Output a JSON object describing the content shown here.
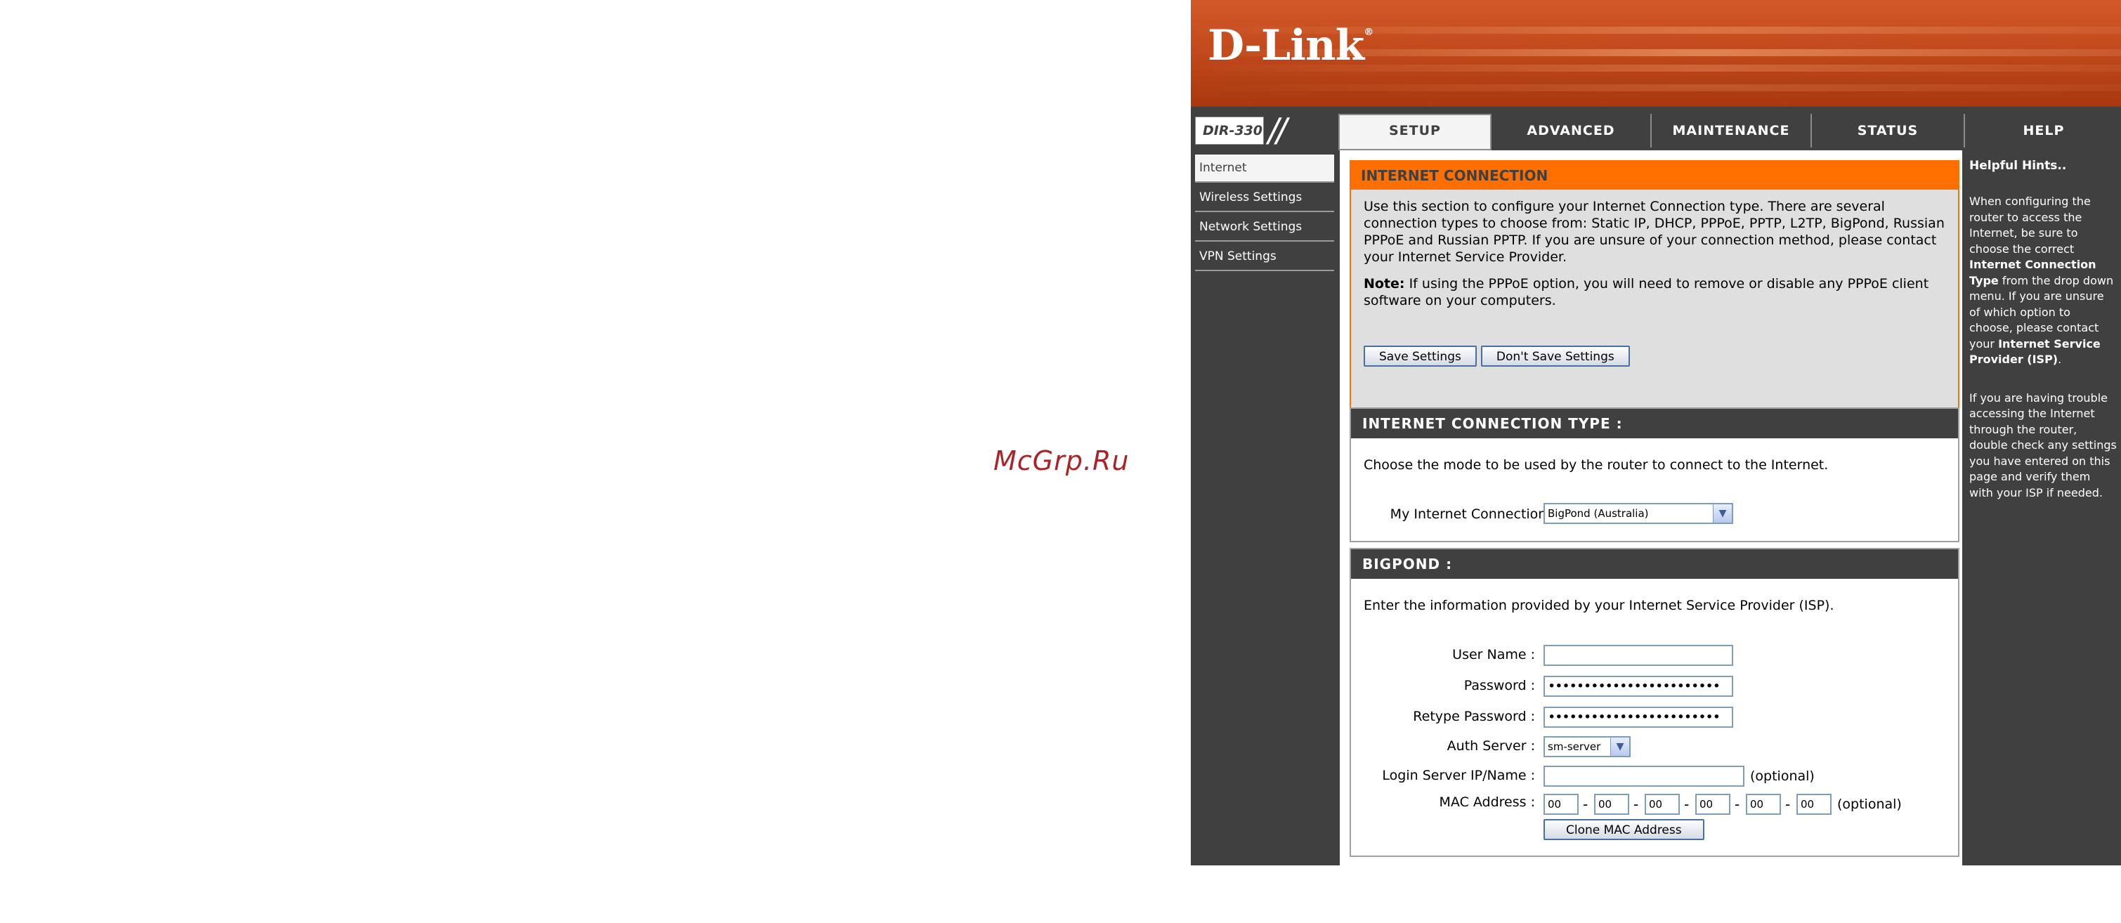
{
  "watermark": "McGrp.Ru",
  "brand": {
    "logo": "D-Link",
    "trademark": "®",
    "model": "DIR-330",
    "accent": "#ff6f00",
    "dark": "#404040"
  },
  "tabs": [
    {
      "label": "SETUP",
      "active": true
    },
    {
      "label": "ADVANCED"
    },
    {
      "label": "MAINTENANCE"
    },
    {
      "label": "STATUS"
    },
    {
      "label": "HELP"
    }
  ],
  "sidebar": {
    "items": [
      {
        "label": "Internet",
        "active": true
      },
      {
        "label": "Wireless Settings"
      },
      {
        "label": "Network Settings"
      },
      {
        "label": "VPN Settings"
      }
    ]
  },
  "internet_connection": {
    "title": "INTERNET CONNECTION",
    "description": "Use this section to configure your Internet Connection type. There are several connection types to choose from: Static IP, DHCP, PPPoE, PPTP, L2TP, BigPond, Russian PPPoE and Russian PPTP. If you are unsure of your connection method, please contact your Internet Service Provider.",
    "note_label": "Note:",
    "note_text": " If using the PPPoE option, you will need to remove or disable any PPPoE client software on your computers.",
    "save_label": "Save Settings",
    "dont_save_label": "Don't Save Settings"
  },
  "connection_type": {
    "title": "INTERNET CONNECTION TYPE :",
    "description": "Choose the mode to be used by the router to connect to the Internet.",
    "mode_label": "My Internet Connection is :",
    "mode_value": "BigPond (Australia)"
  },
  "bigpond": {
    "title": "BIGPOND :",
    "description": "Enter the information provided by your Internet Service Provider (ISP).",
    "username_label": "User Name :",
    "username_value": "",
    "password_label": "Password :",
    "password_value": "••••••••••••••••••••••••",
    "retype_label": "Retype Password :",
    "retype_value": "••••••••••••••••••••••••",
    "auth_label": "Auth Server :",
    "auth_value": "sm-server",
    "login_label": "Login Server IP/Name :",
    "login_value": "",
    "optional": "(optional)",
    "mac_label": "MAC Address :",
    "mac": [
      "00",
      "00",
      "00",
      "00",
      "00",
      "00"
    ],
    "dash": "-",
    "clone_label": "Clone MAC Address"
  },
  "help": {
    "title": "Helpful Hints..",
    "p1_a": "When configuring the router to access the Internet, be sure to choose the correct ",
    "p1_b": "Internet Connection Type",
    "p1_c": " from the drop down menu. If you are unsure of which option to choose, please contact your ",
    "p1_d": "Internet Service Provider (ISP)",
    "p1_e": ".",
    "p2": "If you are having trouble accessing the Internet through the router, double check any settings you have entered on this page and verify them with your ISP if needed."
  }
}
